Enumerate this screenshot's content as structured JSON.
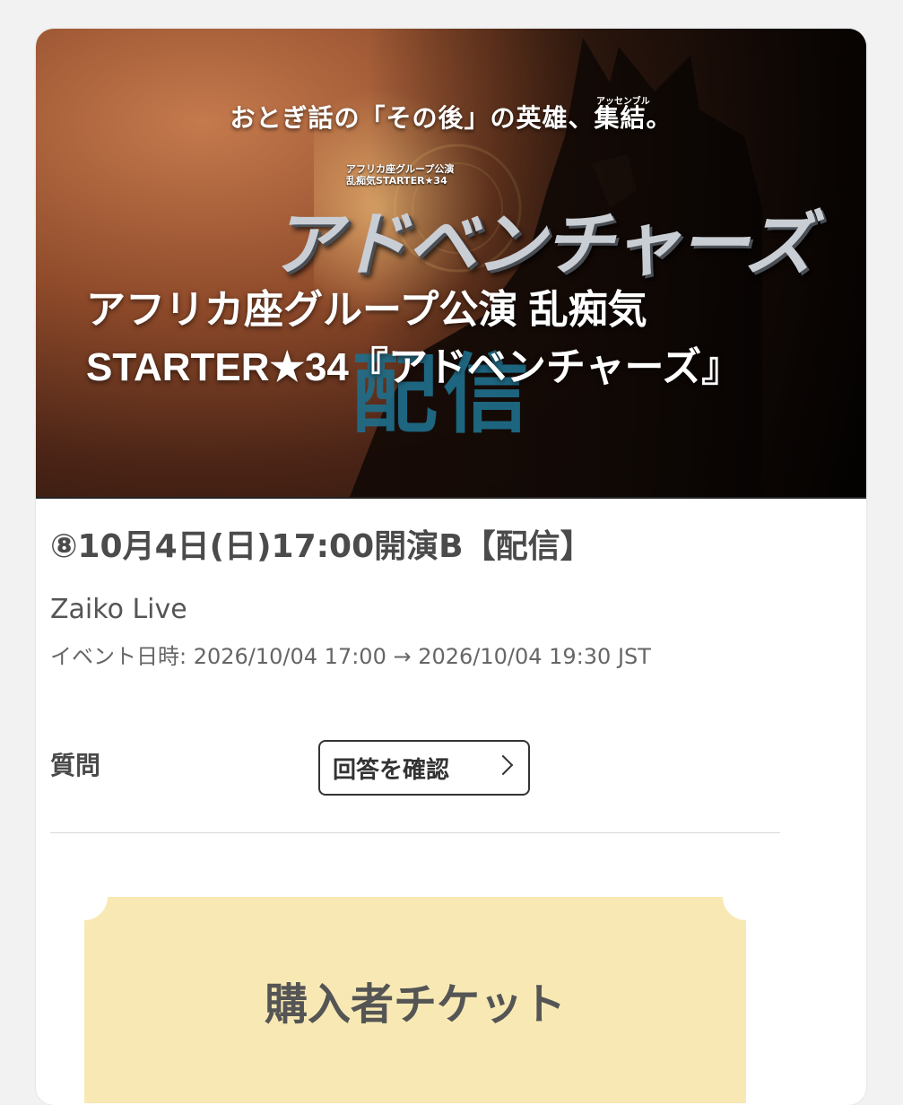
{
  "hero": {
    "tagline": "おとぎ話の「その後」の英雄、集結。",
    "tagline_ruby": "アッセンブル",
    "logo_sub_line1": "アフリカ座グループ公演",
    "logo_sub_line2": "乱痴気STARTER★34",
    "logo_main": "アドベンチャーズ",
    "stream_word": "配信",
    "title": "アフリカ座グループ公演 乱痴気STARTER★34『アドベンチャーズ』"
  },
  "event": {
    "performance_title": "⑧10月4日(日)17:00開演B【配信】",
    "venue": "Zaiko Live",
    "datetime": "イベント日時: 2026/10/04 17:00 → 2026/10/04 19:30 JST"
  },
  "question": {
    "label": "質問",
    "button_label": "回答を確認"
  },
  "ticket": {
    "label": "購入者チケット",
    "color": "#f8e9b4"
  }
}
